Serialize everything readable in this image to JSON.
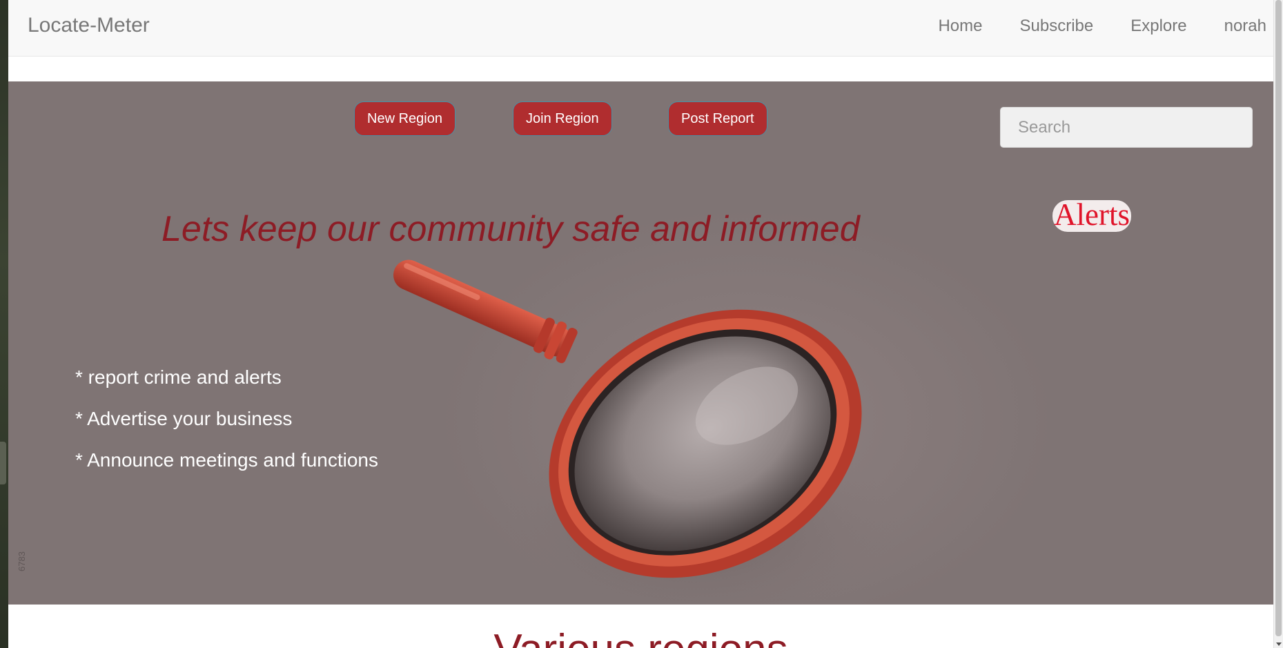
{
  "navbar": {
    "brand": "Locate-Meter",
    "links": [
      "Home",
      "Subscribe",
      "Explore",
      "norah"
    ]
  },
  "hero": {
    "buttons": {
      "new_region": "New Region",
      "join_region": "Join Region",
      "post_report": "Post Report"
    },
    "search": {
      "placeholder": "Search",
      "value": ""
    },
    "tagline": "Lets keep our community safe and informed",
    "alerts_label": "Alerts",
    "features": [
      "* report crime and alerts",
      "* Advertise your business",
      "* Announce meetings and functions"
    ],
    "image_icon": "magnifying-glass-illustration",
    "watermark": "6783"
  },
  "sections": {
    "regions_title": "Various regions"
  },
  "colors": {
    "hero_background": "#7f7474",
    "button_red": "#b02d2f",
    "tagline_red": "#8d1c25",
    "alerts_red": "#e0142a",
    "navbar_background": "#f8f8f8",
    "nav_text": "#777777"
  }
}
